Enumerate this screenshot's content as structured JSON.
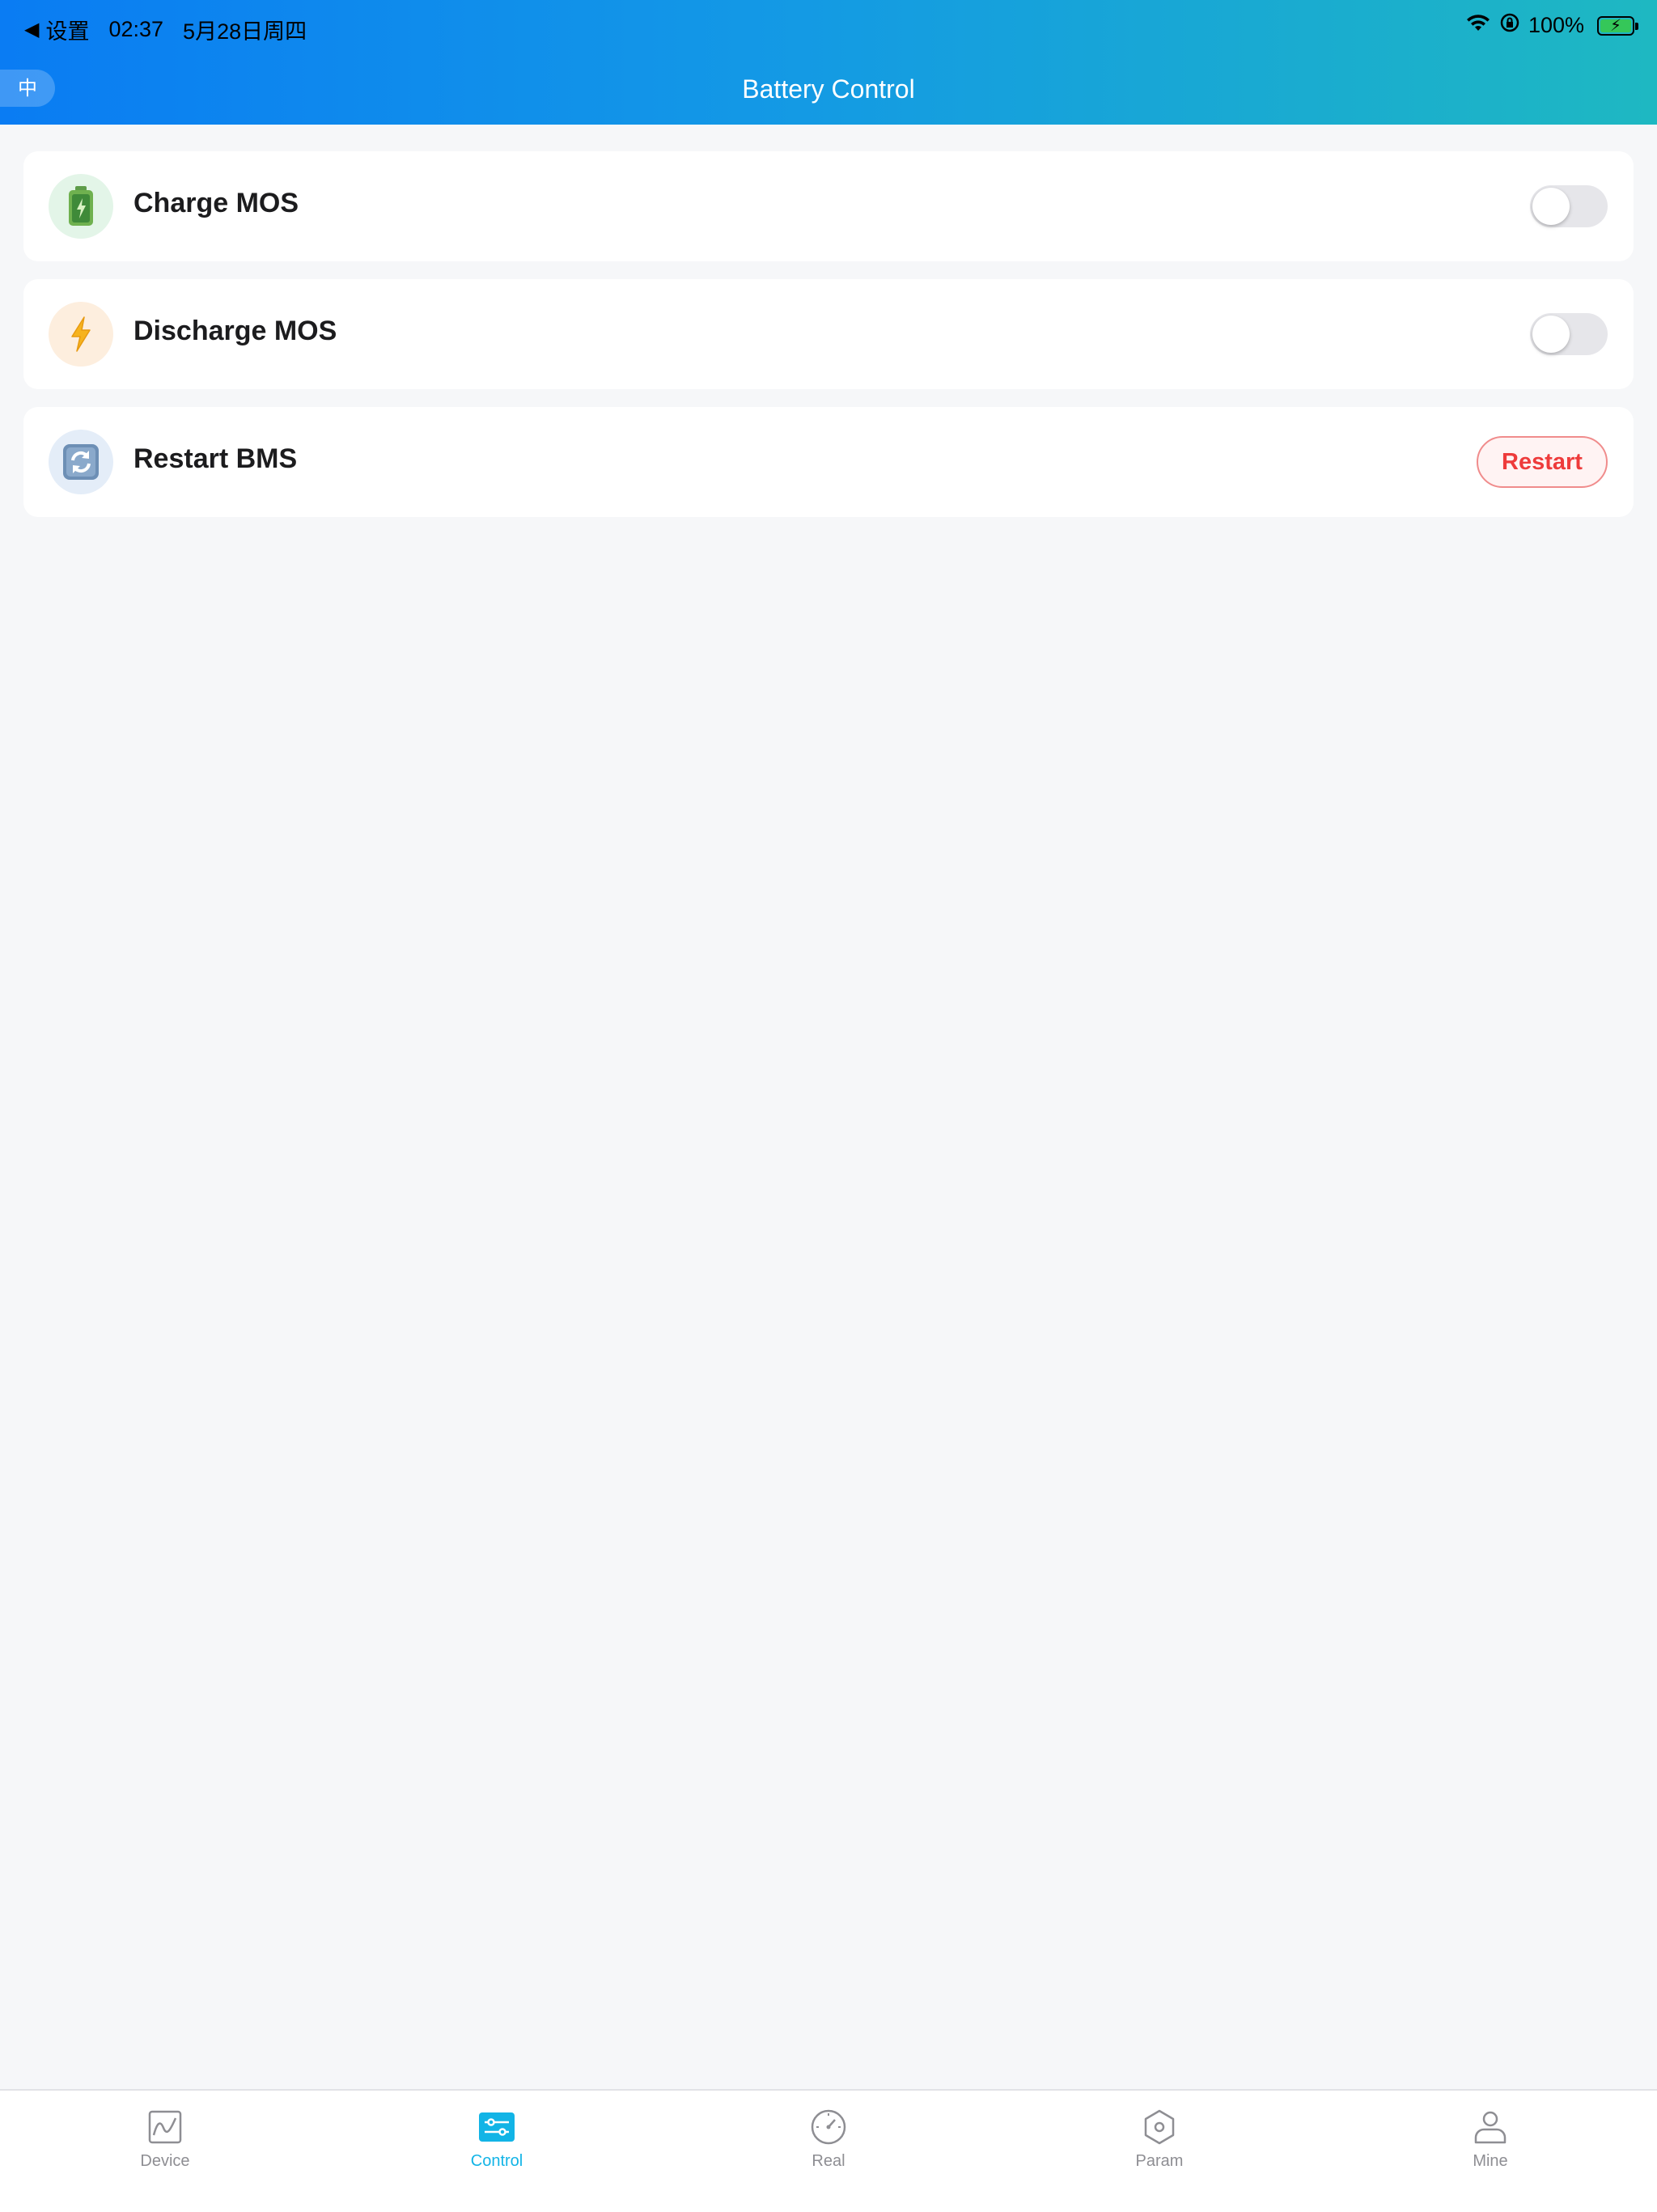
{
  "status_bar": {
    "back_label": "设置",
    "time": "02:37",
    "date": "5月28日周四",
    "battery_percent": "100%",
    "battery_level": 1.0
  },
  "header": {
    "language_button": "中",
    "title": "Battery Control"
  },
  "controls": {
    "charge_mos": {
      "label": "Charge MOS",
      "enabled": false,
      "icon": "battery-icon"
    },
    "discharge_mos": {
      "label": "Discharge MOS",
      "enabled": false,
      "icon": "lightning-icon"
    },
    "restart_bms": {
      "label": "Restart BMS",
      "button_label": "Restart",
      "icon": "refresh-icon"
    }
  },
  "tab_bar": {
    "active": "Control",
    "tabs": [
      {
        "label": "Device",
        "icon": "chart-icon"
      },
      {
        "label": "Control",
        "icon": "sliders-icon"
      },
      {
        "label": "Real",
        "icon": "gauge-icon"
      },
      {
        "label": "Param",
        "icon": "hexagon-nut-icon"
      },
      {
        "label": "Mine",
        "icon": "user-icon"
      }
    ]
  },
  "colors": {
    "header_gradient_start": "#0a7cf3",
    "header_gradient_end": "#1eb8c2",
    "accent": "#12b4e6",
    "restart_red": "#ee3b3b",
    "toggle_off": "#e6e6ea"
  }
}
